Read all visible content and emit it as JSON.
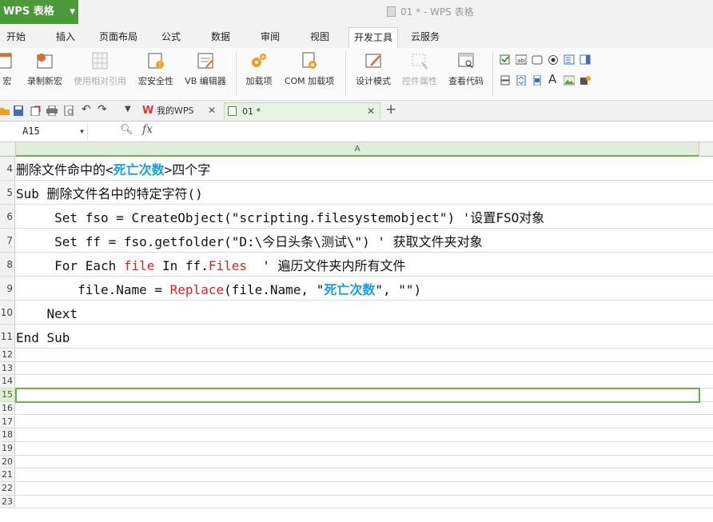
{
  "app": {
    "menu_label": "WPS 表格",
    "doc_title": "01 * - WPS 表格"
  },
  "ribbon_tabs": [
    "开始",
    "插入",
    "页面布局",
    "公式",
    "数据",
    "审阅",
    "视图",
    "开发工具",
    "云服务"
  ],
  "active_tab": "开发工具",
  "ribbon_buttons": {
    "macro": "宏",
    "record_macro": "录制新宏",
    "relative_ref": "使用相对引用",
    "macro_security": "宏安全性",
    "vb_editor": "VB 编辑器",
    "addins": "加载项",
    "com_addins": "COM 加载项",
    "design_mode": "设计模式",
    "control_props": "控件属性",
    "view_code": "查看代码"
  },
  "doc_tabs": {
    "home": "我的WPS",
    "file": "01 *"
  },
  "formula_bar": {
    "name_box": "A15",
    "fx": "fx"
  },
  "column_header": "A",
  "rows": [
    {
      "num": "4",
      "segments": [
        {
          "t": "删除文件命中的<",
          "c": ""
        },
        {
          "t": "死亡次数",
          "c": "blue"
        },
        {
          "t": ">四个字",
          "c": ""
        }
      ]
    },
    {
      "num": "5",
      "segments": [
        {
          "t": "Sub 删除文件名中的特定字符()",
          "c": ""
        }
      ]
    },
    {
      "num": "6",
      "segments": [
        {
          "t": "     Set fso = CreateObject(\"scripting.filesystemobject\") '设置FSO对象",
          "c": ""
        }
      ]
    },
    {
      "num": "7",
      "segments": [
        {
          "t": "     Set ff = fso.getfolder(\"D:\\今日头条\\测试\\\") ' 获取文件夹对象",
          "c": ""
        }
      ]
    },
    {
      "num": "8",
      "segments": [
        {
          "t": "     For Each ",
          "c": ""
        },
        {
          "t": "file",
          "c": "red"
        },
        {
          "t": " In ff.",
          "c": ""
        },
        {
          "t": "Files",
          "c": "red"
        },
        {
          "t": "  ' 遍历文件夹内所有文件",
          "c": ""
        }
      ]
    },
    {
      "num": "9",
      "segments": [
        {
          "t": "        file.Name = ",
          "c": ""
        },
        {
          "t": "Replace",
          "c": "red"
        },
        {
          "t": "(file.Name, \"",
          "c": ""
        },
        {
          "t": "死亡次数",
          "c": "blue"
        },
        {
          "t": "\", \"\")",
          "c": ""
        }
      ]
    },
    {
      "num": "10",
      "segments": [
        {
          "t": "    Next",
          "c": ""
        }
      ]
    },
    {
      "num": "11",
      "segments": [
        {
          "t": "End Sub",
          "c": ""
        }
      ]
    },
    {
      "num": "12",
      "segments": []
    },
    {
      "num": "13",
      "segments": []
    },
    {
      "num": "14",
      "segments": []
    },
    {
      "num": "15",
      "segments": []
    },
    {
      "num": "16",
      "segments": []
    },
    {
      "num": "17",
      "segments": []
    },
    {
      "num": "18",
      "segments": []
    },
    {
      "num": "19",
      "segments": []
    },
    {
      "num": "20",
      "segments": []
    },
    {
      "num": "21",
      "segments": []
    },
    {
      "num": "22",
      "segments": []
    },
    {
      "num": "23",
      "segments": []
    }
  ],
  "selected_row": "15",
  "colors": {
    "accent": "#4a9a3a",
    "keyword_red": "#e01f1f",
    "text_blue": "#16a0e0"
  }
}
